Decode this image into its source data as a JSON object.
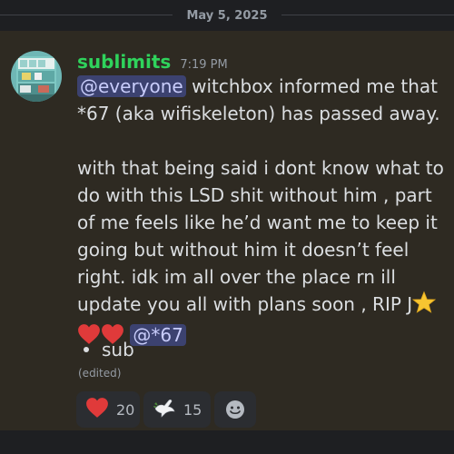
{
  "divider": {
    "date": "May 5, 2025"
  },
  "message": {
    "username": "sublimits",
    "time": "7:19 PM",
    "mention_everyone": "@everyone",
    "line1_rest": " witchbox informed me that *67 (aka wifiskeleton) has passed away.",
    "para2": "with that being said i dont know what to do with this LSD shit without him , part of me feels like he’d want me to keep it going but without him it doesn’t feel right. idk im all over the place rn ill update you all with plans soon , RIP J",
    "mention_user": "@*67",
    "bullet": "sub",
    "edited": "(edited)"
  },
  "reactions": [
    {
      "emoji": "red-heart",
      "count": "20"
    },
    {
      "emoji": "dove",
      "count": "15"
    }
  ],
  "colors": {
    "username": "#2fd35c",
    "highlight_bg": "#2e2a22",
    "mention_bg": "#3c4270",
    "mention_fg": "#c9cdfb"
  }
}
